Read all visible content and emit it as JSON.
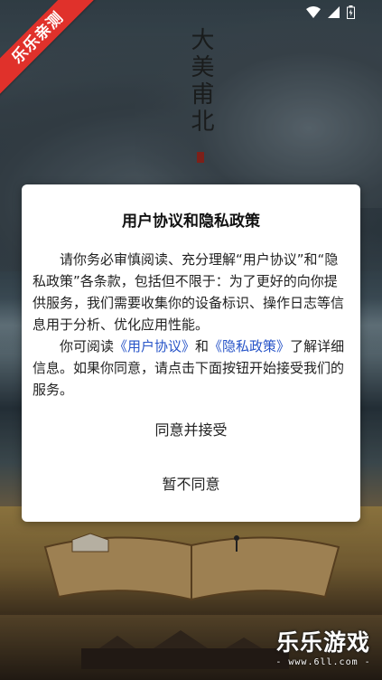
{
  "splash": {
    "vertical_title": "大美甫北"
  },
  "ribbon": {
    "label": "乐乐亲测"
  },
  "status_bar": {
    "icons": [
      "wifi-icon",
      "signal-icon",
      "battery-icon"
    ]
  },
  "dialog": {
    "title": "用户协议和隐私政策",
    "para1": "请你务必审慎阅读、充分理解“用户协议”和“隐私政策”各条款，包括但不限于：为了更好的向你提供服务，我们需要收集你的设备标识、操作日志等信息用于分析、优化应用性能。",
    "para2_prefix": "你可阅读",
    "link_user_agreement": "《用户协议》",
    "para2_and": "和",
    "link_privacy_policy": "《隐私政策》",
    "para2_suffix": "了解详细信息。如果你同意，请点击下面按钮开始接受我们的服务。",
    "accept_label": "同意并接受",
    "decline_label": "暂不同意",
    "link_color": "#2754c8"
  },
  "watermark": {
    "logo": "乐乐游戏",
    "url": "- www.6ll.com -"
  }
}
